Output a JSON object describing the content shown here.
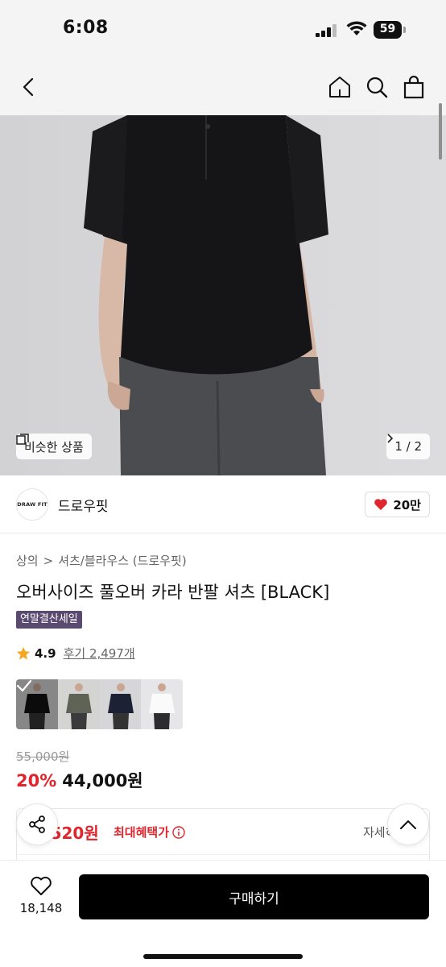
{
  "status_bar": {
    "time": "6:08",
    "battery": "59"
  },
  "nav": {
    "back_icon": "chevron-left-icon",
    "home_icon": "home-icon",
    "search_icon": "search-icon",
    "cart_icon": "shopping-bag-icon"
  },
  "hero": {
    "similar_label": "비슷한 상품",
    "pager": "1 / 2"
  },
  "brand": {
    "logo_text": "DRAW FIT",
    "name": "드로우핏",
    "likes": "20만",
    "like_color": "#e0252d"
  },
  "product": {
    "breadcrumb": [
      "상의",
      "셔츠/블라우스 (드로우핏)"
    ],
    "breadcrumb_sep": ">",
    "title": "오버사이즈 풀오버 카라 반팔 셔츠 [BLACK]",
    "badge": "연말결산세일",
    "badge_color": "#5a4a6f",
    "rating": "4.9",
    "reviews": "후기 2,497개",
    "color_thumbs": [
      "black",
      "khaki",
      "navy",
      "white"
    ],
    "original_price": "55,000원",
    "discount": "20%",
    "price": "44,000원",
    "accent_color": "#e0252d"
  },
  "benefit": {
    "price": ",520원",
    "label": "최대혜택가",
    "detail": "자세히"
  },
  "bottom": {
    "wish_count": "18,148",
    "buy_label": "구매하기"
  }
}
